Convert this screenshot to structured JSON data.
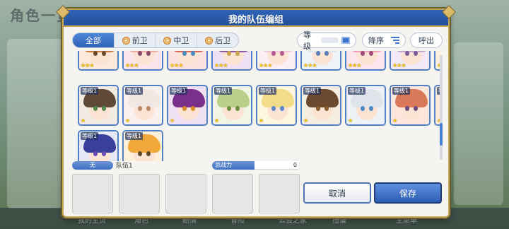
{
  "background": {
    "title": "角色一览",
    "bottom_items": [
      "我的主页",
      "角色",
      "剧情",
      "冒险",
      "公会之家",
      "扭蛋",
      "主菜单"
    ]
  },
  "dialog": {
    "title": "我的队伍编组"
  },
  "filters": {
    "tabs": [
      {
        "label": "全部",
        "active": true,
        "icon": "none"
      },
      {
        "label": "前卫",
        "active": false,
        "icon": "front-position-icon"
      },
      {
        "label": "中卫",
        "active": false,
        "icon": "middle-position-icon"
      },
      {
        "label": "后卫",
        "active": false,
        "icon": "back-position-icon"
      }
    ],
    "sort_key": "等级",
    "sort_order": "降序",
    "summon": "呼出"
  },
  "characters": [
    {
      "level": "",
      "stars": 3,
      "hair": "#c97b3f",
      "eye": "#6c4a2a",
      "bg": "#fde9d9",
      "partial": true
    },
    {
      "level": "",
      "stars": 3,
      "hair": "#e8a9a5",
      "eye": "#8b4b67",
      "bg": "#fbe5ea",
      "partial": true
    },
    {
      "level": "",
      "stars": 3,
      "hair": "#d9655a",
      "eye": "#4a8bc2",
      "bg": "#fde3e0",
      "partial": true
    },
    {
      "level": "",
      "stars": 3,
      "hair": "#8a5a9e",
      "eye": "#c9a24a",
      "bg": "#efe1f3",
      "partial": true
    },
    {
      "level": "",
      "stars": 3,
      "hair": "#f2c7d7",
      "eye": "#b4598e",
      "bg": "#fdf0f5",
      "partial": true
    },
    {
      "level": "",
      "stars": 3,
      "hair": "#dfe6ee",
      "eye": "#5a7fb4",
      "bg": "#eef3f8",
      "partial": true
    },
    {
      "level": "",
      "stars": 3,
      "hair": "#f0a0b8",
      "eye": "#a04a7a",
      "bg": "#fde6ee",
      "partial": true
    },
    {
      "level": "",
      "stars": 3,
      "hair": "#bfa7c9",
      "eye": "#7a5a9a",
      "bg": "#f1e9f5",
      "partial": true
    },
    {
      "level": "",
      "stars": 3,
      "hair": "#f2b36a",
      "eye": "#8a5a2a",
      "bg": "#fdf0de",
      "partial": true
    },
    {
      "level": "等级1",
      "stars": 1,
      "hair": "#5e4a36",
      "eye": "#4f8a4a",
      "bg": "#f1ebe2",
      "partial": false
    },
    {
      "level": "等级1",
      "stars": 1,
      "hair": "#f3e7e3",
      "eye": "#b8866a",
      "bg": "#f9f1ee",
      "partial": false
    },
    {
      "level": "等级1",
      "stars": 1,
      "hair": "#7a2f8a",
      "eye": "#d88a2a",
      "bg": "#efe0f3",
      "partial": false
    },
    {
      "level": "等级1",
      "stars": 1,
      "hair": "#b9cf8a",
      "eye": "#6a8f3a",
      "bg": "#f1f6e4",
      "partial": false
    },
    {
      "level": "等级1",
      "stars": 1,
      "hair": "#f2dc8a",
      "eye": "#5a86c4",
      "bg": "#fdf7e0",
      "partial": false
    },
    {
      "level": "等级1",
      "stars": 1,
      "hair": "#6b4a30",
      "eye": "#8a5a2a",
      "bg": "#f5ece2",
      "partial": false
    },
    {
      "level": "等级1",
      "stars": 1,
      "hair": "#dfe3ea",
      "eye": "#4a8ac4",
      "bg": "#eef2f7",
      "partial": false
    },
    {
      "level": "等级1",
      "stars": 1,
      "hair": "#d9795a",
      "eye": "#6a4a7a",
      "bg": "#fde6dc",
      "partial": false
    },
    {
      "level": "等级1",
      "stars": 1,
      "hair": "#f08a3a",
      "eye": "#4a9a5a",
      "bg": "#fdebdc",
      "partial": false
    },
    {
      "level": "等级1",
      "stars": 1,
      "hair": "#3a3f9e",
      "eye": "#6a4ab4",
      "bg": "#e6e7f6",
      "partial": false
    },
    {
      "level": "等级1",
      "stars": 1,
      "hair": "#f0a83a",
      "eye": "#5a4a2a",
      "bg": "#fdf1dc",
      "partial": false
    }
  ],
  "team": {
    "chip": "无",
    "name": "队伍1",
    "power_label": "总战力",
    "power_value": "0",
    "slot_count": 5
  },
  "buttons": {
    "cancel": "取消",
    "save": "保存"
  },
  "colors": {
    "header": "#2f63b6",
    "gold_border": "#c9a85a",
    "save_button": "#2f5fb3"
  }
}
